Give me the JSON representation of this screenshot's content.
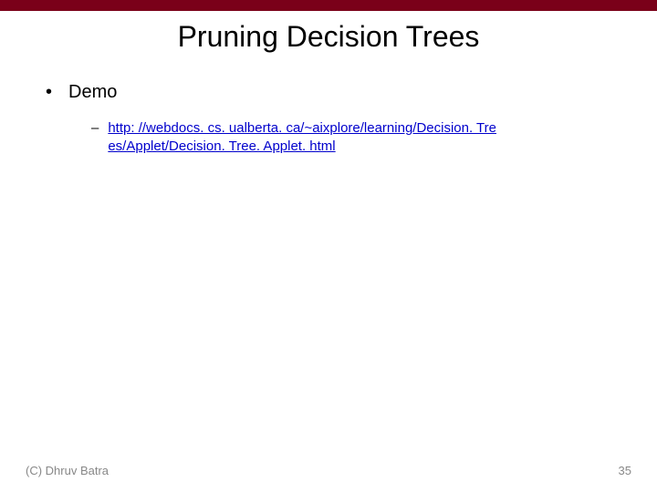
{
  "slide": {
    "title": "Pruning Decision Trees",
    "bullet1": {
      "label": "Demo"
    },
    "sub1": {
      "link_text": "http: //webdocs. cs. ualberta. ca/~aixplore/learning/Decision. Tre es/Applet/Decision. Tree. Applet. html"
    },
    "footer_left": "(C) Dhruv Batra",
    "footer_right": "35"
  }
}
